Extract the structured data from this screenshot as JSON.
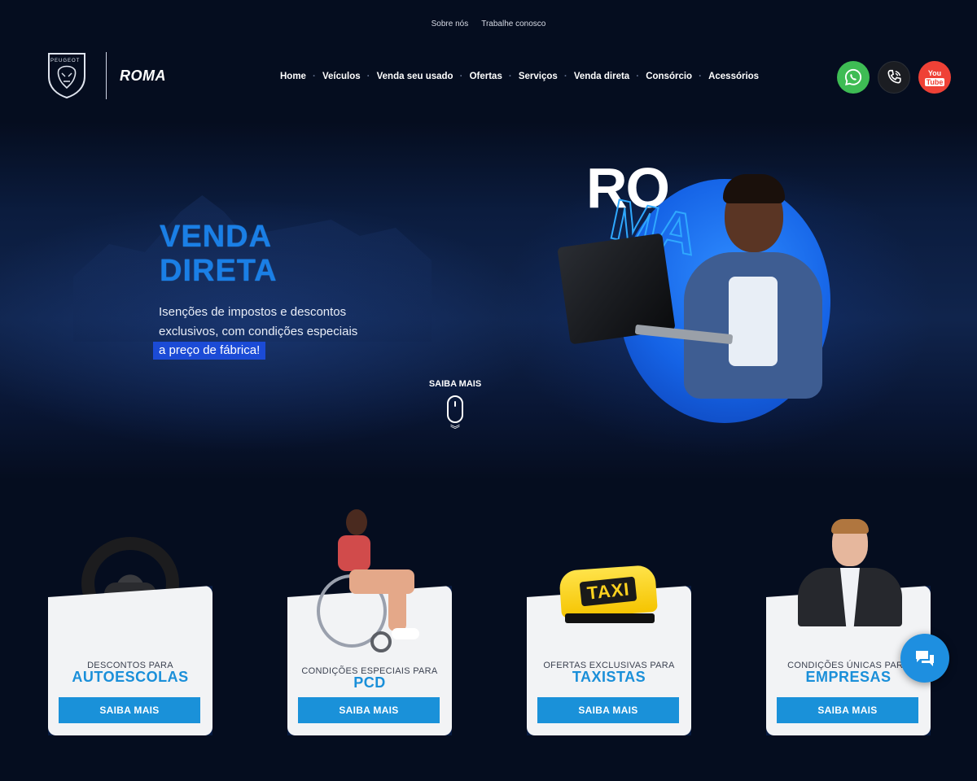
{
  "top_links": [
    "Sobre nós",
    "Trabalhe conosco"
  ],
  "brand": {
    "logo_text": "PEUGEOT",
    "dealer_name": "ROMA"
  },
  "nav": [
    "Home",
    "Veículos",
    "Venda seu usado",
    "Ofertas",
    "Serviços",
    "Venda direta",
    "Consórcio",
    "Acessórios"
  ],
  "social": {
    "whatsapp_icon": "whatsapp-icon",
    "phone_icon": "phone-icon",
    "youtube_icon": "youtube-icon",
    "youtube_text_top": "You",
    "youtube_text_bottom": "Tube"
  },
  "hero": {
    "title_line1": "VENDA",
    "title_line2": "DIRETA",
    "subtitle": "Isenções de impostos e descontos exclusivos, com condições especiais",
    "highlight": "a preço de fábrica!",
    "scroll_label": "SAIBA MAIS",
    "letters_top": "RO",
    "letters_outline": "MA"
  },
  "cards": [
    {
      "small": "DESCONTOS PARA",
      "big": "AUTOESCOLAS",
      "button": "SAIBA MAIS"
    },
    {
      "small": "CONDIÇÕES ESPECIAIS PARA",
      "big": "PCD",
      "button": "SAIBA MAIS"
    },
    {
      "small": "OFERTAS EXCLUSIVAS PARA",
      "big": "TAXISTAS",
      "button": "SAIBA MAIS",
      "taxi_sign": "TAXI"
    },
    {
      "small": "CONDIÇÕES ÚNICAS PARA",
      "big": "EMPRESAS",
      "button": "SAIBA MAIS"
    }
  ],
  "colors": {
    "background": "#050d1f",
    "accent_blue": "#1a91d9",
    "hero_title": "#1a7fe6",
    "highlight_bg": "#1b4bd6",
    "whatsapp": "#3ebc54",
    "youtube": "#ef4136"
  }
}
